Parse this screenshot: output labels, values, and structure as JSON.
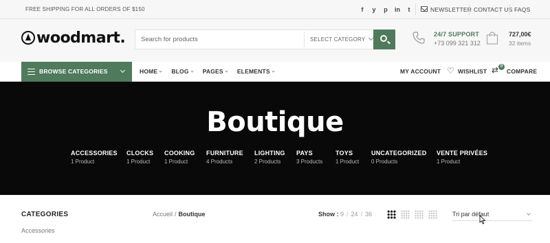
{
  "topbar": {
    "promo": "FREE SHIPPING FOR ALL ORDERS OF $150",
    "social_icons": [
      "facebook-icon",
      "twitter-icon",
      "pinterest-icon",
      "linkedin-icon",
      "telegram-icon"
    ],
    "social_glyphs": [
      "f",
      "y",
      "p",
      "in",
      "t"
    ],
    "newsletter": "NEWSLETTER",
    "contact": "CONTACT US",
    "faqs": "FAQS"
  },
  "header": {
    "logo": "woodmart.",
    "search": {
      "placeholder": "Search for products",
      "category": "SELECT CATEGORY"
    },
    "support": {
      "title": "24/7 SUPPORT",
      "phone": "+73 099 321 312"
    },
    "cart": {
      "total": "727,00€",
      "items": "32 items"
    }
  },
  "nav": {
    "browse": "BROWSE CATEGORIES",
    "menu": [
      {
        "label": "HOME"
      },
      {
        "label": "BLOG"
      },
      {
        "label": "PAGES"
      },
      {
        "label": "ELEMENTS"
      }
    ],
    "my_account": "MY ACCOUNT",
    "wishlist": "WISHLIST",
    "compare": "COMPARE",
    "compare_count": "0"
  },
  "hero": {
    "title": "Boutique",
    "categories": [
      {
        "name": "ACCESSORIES",
        "count": "1 Product"
      },
      {
        "name": "CLOCKS",
        "count": "1 Product"
      },
      {
        "name": "COOKING",
        "count": "1 Product"
      },
      {
        "name": "FURNITURE",
        "count": "4 Products"
      },
      {
        "name": "LIGHTING",
        "count": "2 Products"
      },
      {
        "name": "PAYS",
        "count": "3 Products"
      },
      {
        "name": "TOYS",
        "count": "1 Product"
      },
      {
        "name": "UNCATEGORIZED",
        "count": "0 Products"
      },
      {
        "name": "VENTE PRIVÉES",
        "count": "1 Product"
      }
    ]
  },
  "shop": {
    "sidebar_title": "CATEGORIES",
    "sidebar_items": [
      "Accessories"
    ],
    "breadcrumb": {
      "home": "Accueil",
      "separator": "/",
      "current": "Boutique"
    },
    "show": {
      "label": "Show :",
      "options": [
        "9",
        "24",
        "36"
      ]
    },
    "sort": "Tri par défaut"
  },
  "colors": {
    "accent": "#4f7a5c",
    "hero_bg": "#090909",
    "topbar_bg": "#f7f7f7"
  }
}
